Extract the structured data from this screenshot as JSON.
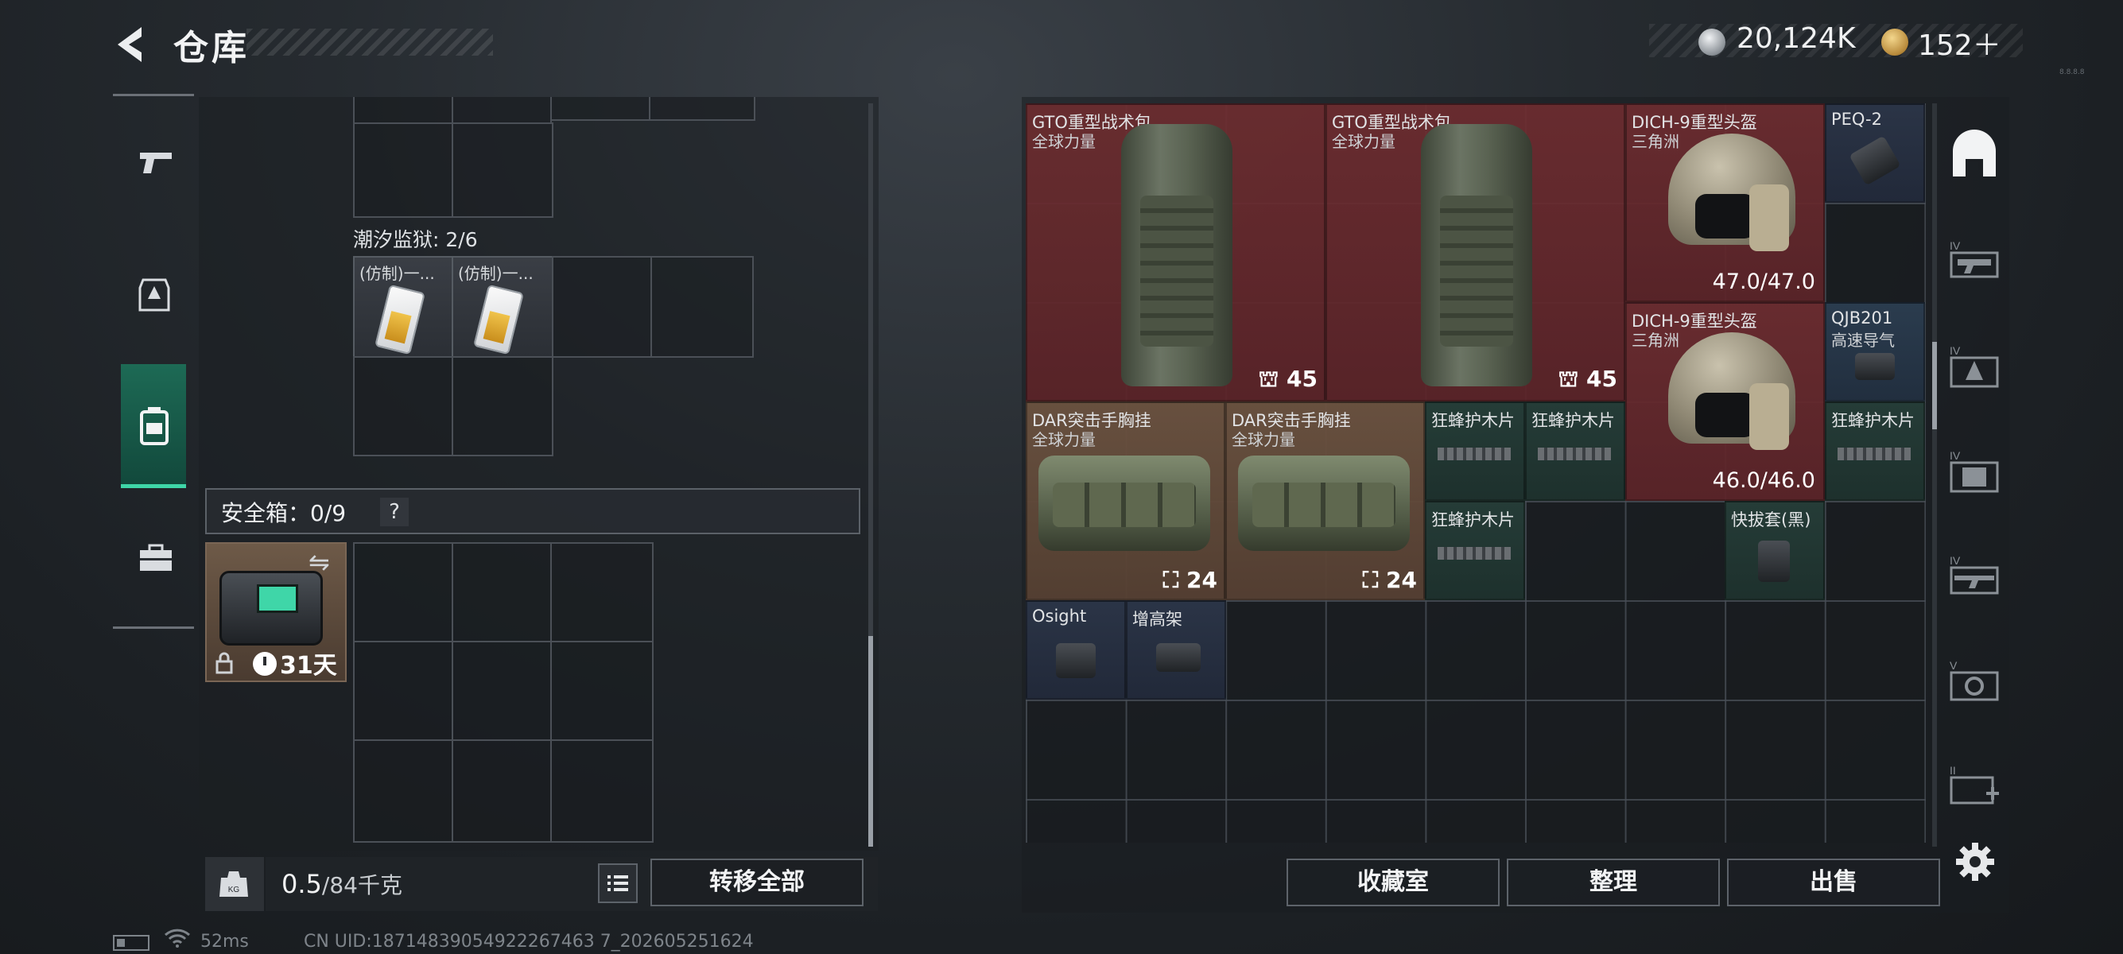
{
  "header": {
    "title": "仓库",
    "currency": [
      {
        "name": "silver-coin",
        "value": "20,124K"
      },
      {
        "name": "gold-coin",
        "value": "152＋"
      }
    ],
    "version": "8.8.8.8"
  },
  "left_rail": {
    "items": [
      {
        "icon": "pistol-icon",
        "active": false
      },
      {
        "icon": "armor-vest-icon",
        "active": false
      },
      {
        "icon": "backpack-icon",
        "active": true
      },
      {
        "icon": "toolbox-icon",
        "active": false
      }
    ]
  },
  "container": {
    "tide_prison": "潮汐监狱: 2/6",
    "key_cards": [
      {
        "name": "(仿制)一..."
      },
      {
        "name": "(仿制)一..."
      }
    ],
    "safe_box": {
      "label": "安全箱：0/9",
      "help": "?",
      "days": "31天"
    },
    "weight": {
      "current": "0.5",
      "max": "/84千克"
    },
    "transfer_all": "转移全部"
  },
  "stash": {
    "items": [
      {
        "id": "gto-1",
        "name": "GTO重型战术包",
        "faction": "全球力量",
        "count": "45",
        "color": "red"
      },
      {
        "id": "gto-2",
        "name": "GTO重型战术包",
        "faction": "全球力量",
        "count": "45",
        "color": "red"
      },
      {
        "id": "helmet-1",
        "name": "DICH-9重型头盔",
        "faction": "三角洲",
        "durability": "47.0/47.0",
        "color": "red"
      },
      {
        "id": "peq2",
        "name": "PEQ-2",
        "color": "navy"
      },
      {
        "id": "helmet-2",
        "name": "DICH-9重型头盔",
        "faction": "三角洲",
        "durability": "46.0/46.0",
        "color": "red"
      },
      {
        "id": "qjb201",
        "name": "QJB201",
        "sub": "高速导气",
        "color": "blue"
      },
      {
        "id": "dar-1",
        "name": "DAR突击手胸挂",
        "faction": "全球力量",
        "count": "24",
        "color": "brown"
      },
      {
        "id": "dar-2",
        "name": "DAR突击手胸挂",
        "faction": "全球力量",
        "count": "24",
        "color": "brown"
      },
      {
        "id": "wood-1",
        "name": "狂蜂护木片",
        "color": "green"
      },
      {
        "id": "wood-2",
        "name": "狂蜂护木片",
        "color": "green"
      },
      {
        "id": "wood-3",
        "name": "狂蜂护木片",
        "color": "green"
      },
      {
        "id": "wood-4",
        "name": "狂蜂护木片",
        "color": "green"
      },
      {
        "id": "holster",
        "name": "快拔套(黑)",
        "color": "green"
      },
      {
        "id": "osight",
        "name": "Osight",
        "color": "navy"
      },
      {
        "id": "riser",
        "name": "增高架",
        "color": "navy"
      }
    ],
    "side_tabs": [
      {
        "icon": "safehouse-icon",
        "label": ""
      },
      {
        "icon": "rifle-tier-icon",
        "label": "IV"
      },
      {
        "icon": "armor-tier-icon",
        "label": "IV"
      },
      {
        "icon": "rig-tier-icon",
        "label": "IV"
      },
      {
        "icon": "sniper-tier-icon",
        "label": "IV"
      },
      {
        "icon": "scope-tier-icon",
        "label": "V"
      },
      {
        "icon": "medkit-tier-icon",
        "label": "II"
      }
    ],
    "buttons": {
      "collection": "收藏室",
      "sort": "整理",
      "sell": "出售"
    }
  },
  "status": {
    "ping": "52ms",
    "uid": "CN UID:18714839054922267463 7_202605251624"
  }
}
